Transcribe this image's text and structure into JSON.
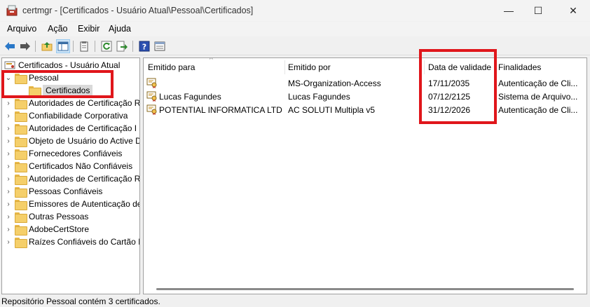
{
  "window": {
    "title": "certmgr - [Certificados - Usuário Atual\\Pessoal\\Certificados]",
    "minimize_glyph": "—",
    "maximize_glyph": "☐",
    "close_glyph": "✕"
  },
  "menu": [
    "Arquivo",
    "Ação",
    "Exibir",
    "Ajuda"
  ],
  "toolbar": {
    "icons": [
      "back-icon",
      "forward-icon",
      "up-folder-icon",
      "show-hide-tree-icon",
      "clipboard-icon",
      "refresh-icon",
      "export-icon",
      "help-icon",
      "view-icon"
    ]
  },
  "tree": {
    "root": "Certificados - Usuário Atual",
    "expanded": "Pessoal",
    "selected_child": "Certificados",
    "collapsed_glyph": "›",
    "expanded_glyph": "⌄",
    "items": [
      "Autoridades de Certificação R",
      "Confiabilidade Corporativa",
      "Autoridades de Certificação I",
      "Objeto de Usuário do Active D",
      "Fornecedores Confiáveis",
      "Certificados Não Confiáveis",
      "Autoridades de Certificação R",
      "Pessoas Confiáveis",
      "Emissores de Autenticação de",
      "Outras Pessoas",
      "AdobeCertStore",
      "Raízes Confiáveis do Cartão In"
    ]
  },
  "list": {
    "sort_glyph": "^",
    "columns": [
      "Emitido para",
      "Emitido por",
      "Data de validade",
      "Finalidades"
    ],
    "rows": [
      {
        "issued_to": "",
        "issued_by": "MS-Organization-Access",
        "expiry": "17/11/2035",
        "purposes": "Autenticação de Cli..."
      },
      {
        "issued_to": "Lucas Fagundes",
        "issued_by": "Lucas Fagundes",
        "expiry": "07/12/2125",
        "purposes": "Sistema de Arquivo..."
      },
      {
        "issued_to": "POTENTIAL INFORMATICA LTD...",
        "issued_by": "AC SOLUTI Multipla v5",
        "expiry": "31/12/2026",
        "purposes": "Autenticação de Cli..."
      }
    ]
  },
  "status": "Repositório Pessoal contém 3 certificados.",
  "colors": {
    "highlight": "#e0161b",
    "folder": "#f5cf6a"
  }
}
